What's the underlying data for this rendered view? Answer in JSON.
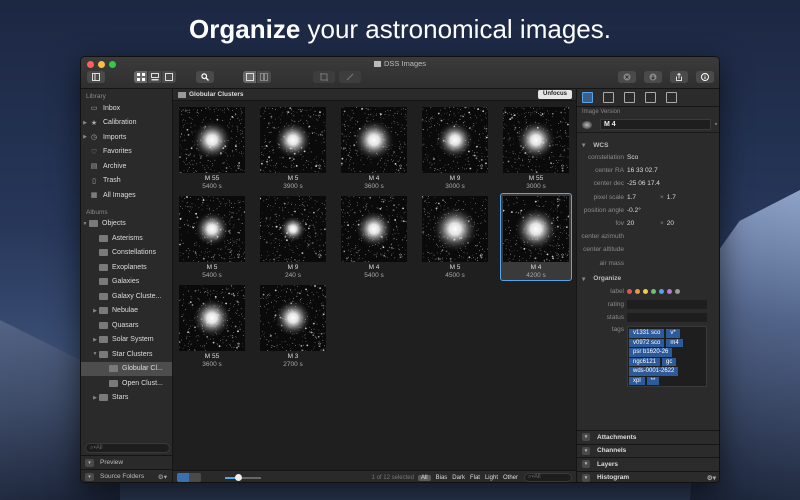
{
  "headline": {
    "bold": "Organize",
    "rest": " your astronomical images."
  },
  "window": {
    "title": "DSS Images"
  },
  "colors": {
    "accent": "#5aa3e6",
    "tag": "#2d5a9a"
  },
  "sidebar": {
    "library_header": "Library",
    "library_items": [
      {
        "label": "Inbox",
        "icon": "inbox-icon"
      },
      {
        "label": "Calibration",
        "icon": "star-icon",
        "expandable": true
      },
      {
        "label": "Imports",
        "icon": "clock-icon",
        "expandable": true
      },
      {
        "label": "Favorites",
        "icon": "heart-icon"
      },
      {
        "label": "Archive",
        "icon": "archive-icon"
      },
      {
        "label": "Trash",
        "icon": "trash-icon"
      },
      {
        "label": "All Images",
        "icon": "images-icon"
      }
    ],
    "albums_header": "Albums",
    "albums": [
      {
        "label": "Objects",
        "level": 0,
        "expanded": true
      },
      {
        "label": "Asterisms",
        "level": 1
      },
      {
        "label": "Constellations",
        "level": 1
      },
      {
        "label": "Exoplanets",
        "level": 1
      },
      {
        "label": "Galaxies",
        "level": 1
      },
      {
        "label": "Galaxy Cluste...",
        "level": 1
      },
      {
        "label": "Nebulae",
        "level": 1,
        "expandable": true
      },
      {
        "label": "Quasars",
        "level": 1
      },
      {
        "label": "Solar System",
        "level": 1,
        "expandable": true
      },
      {
        "label": "Star Clusters",
        "level": 1,
        "expanded": true
      },
      {
        "label": "Globular Cl...",
        "level": 2,
        "selected": true
      },
      {
        "label": "Open Clust...",
        "level": 2
      },
      {
        "label": "Stars",
        "level": 1,
        "expandable": true
      }
    ],
    "search_placeholder": "All",
    "preview_label": "Preview",
    "source_folders_label": "Source Folders"
  },
  "content": {
    "header_title": "Globular Clusters",
    "unfocus_label": "Unfocus",
    "images": [
      {
        "name": "M 55",
        "time": "5400 s",
        "density": 0.55
      },
      {
        "name": "M 5",
        "time": "3900 s",
        "density": 0.5
      },
      {
        "name": "M 4",
        "time": "3600 s",
        "density": 0.6
      },
      {
        "name": "M 9",
        "time": "3000 s",
        "density": 0.5
      },
      {
        "name": "M 55",
        "time": "3000 s",
        "density": 0.55
      },
      {
        "name": "M 5",
        "time": "5400 s",
        "density": 0.45
      },
      {
        "name": "M 9",
        "time": "240 s",
        "density": 0.25
      },
      {
        "name": "M 4",
        "time": "5400 s",
        "density": 0.5
      },
      {
        "name": "M 5",
        "time": "4500 s",
        "density": 0.7
      },
      {
        "name": "M 4",
        "time": "4200 s",
        "density": 0.65,
        "selected": true
      },
      {
        "name": "M 55",
        "time": "3600 s",
        "density": 0.55
      },
      {
        "name": "M 3",
        "time": "2700 s",
        "density": 0.5
      }
    ],
    "selection_status": "1 of 12 selected",
    "filters": [
      "All",
      "Bias",
      "Dark",
      "Flat",
      "Light",
      "Other"
    ],
    "active_filter": "All",
    "search_placeholder": "All"
  },
  "inspector": {
    "image_version_header": "Image Version",
    "object_name": "M 4",
    "wcs_header": "WCS",
    "wcs": [
      {
        "key": "constellation",
        "value": "Sco"
      },
      {
        "key": "center RA",
        "value": "16 33 02.7"
      },
      {
        "key": "center dec",
        "value": "-25 06 17.4"
      },
      {
        "key": "pixel scale",
        "value": "1.7",
        "extra": "1.7"
      },
      {
        "key": "position angle",
        "value": "-0.2°"
      },
      {
        "key": "fov",
        "value": "20",
        "extra": "20"
      },
      {
        "key": "center azimuth",
        "value": ""
      },
      {
        "key": "center altitude",
        "value": ""
      },
      {
        "key": "air mass",
        "value": ""
      }
    ],
    "organize_header": "Organize",
    "label_key": "label",
    "label_colors": [
      "#e05555",
      "#e89a3c",
      "#e6cf4a",
      "#6cc36c",
      "#4fa3e8",
      "#b07ad8",
      "#9a9a9a"
    ],
    "rating_key": "rating",
    "status_key": "status",
    "tags_key": "tags",
    "tags": [
      [
        "v1331 sco",
        "v*"
      ],
      [
        "v0972 sco",
        "m4"
      ],
      [
        "psr b1620-26"
      ],
      [
        "ngc6121",
        "gc"
      ],
      [
        "wds-0001-2622"
      ],
      [
        "xpl",
        "**"
      ]
    ],
    "sections": [
      "Attachments",
      "Channels",
      "Layers",
      "Histogram"
    ]
  }
}
